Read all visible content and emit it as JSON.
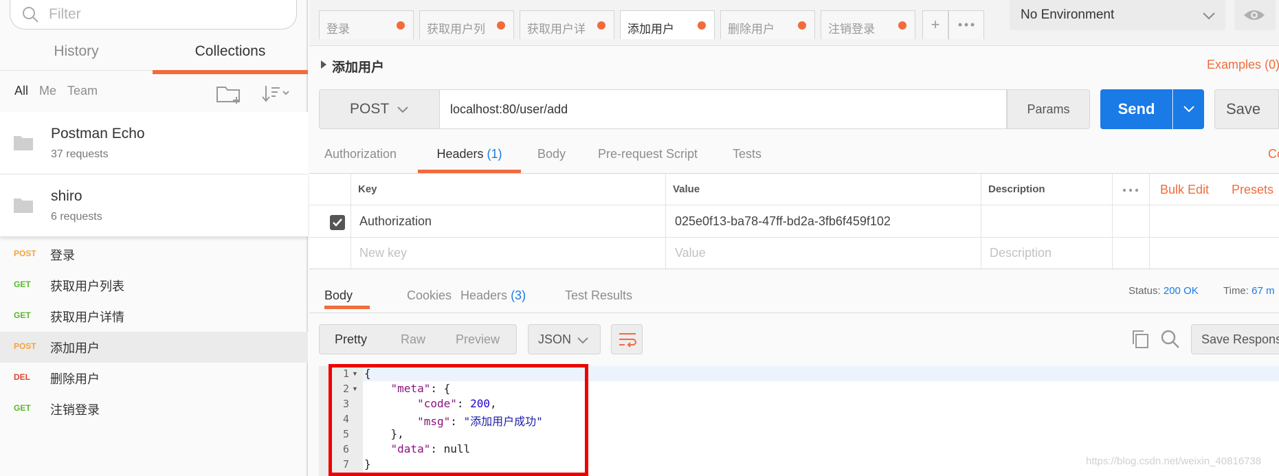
{
  "sidebar": {
    "filter_placeholder": "Filter",
    "tabs": [
      "History",
      "Collections"
    ],
    "owners": [
      "All",
      "Me",
      "Team"
    ],
    "collections": [
      {
        "name": "Postman Echo",
        "count": "37 requests"
      },
      {
        "name": "shiro",
        "count": "6 requests"
      }
    ],
    "requests": [
      {
        "method": "POST",
        "name": "登录"
      },
      {
        "method": "GET",
        "name": "获取用户列表"
      },
      {
        "method": "GET",
        "name": "获取用户详情"
      },
      {
        "method": "POST",
        "name": "添加用户"
      },
      {
        "method": "DEL",
        "name": "删除用户"
      },
      {
        "method": "GET",
        "name": "注销登录"
      }
    ]
  },
  "top_tabs": [
    "登录",
    "获取用户列",
    "获取用户详",
    "添加用户",
    "删除用户",
    "注销登录"
  ],
  "new_tab_label": "+",
  "environment": "No Environment",
  "request": {
    "title": "添加用户",
    "examples": "Examples (0)",
    "method": "POST",
    "url": "localhost:80/user/add",
    "params_label": "Params",
    "send_label": "Send",
    "save_label": "Save"
  },
  "request_tabs": {
    "authorization": "Authorization",
    "headers": "Headers",
    "headers_count": "(1)",
    "body": "Body",
    "prerequest": "Pre-request Script",
    "tests": "Tests",
    "code": "Co"
  },
  "headers_table": {
    "col_key": "Key",
    "col_value": "Value",
    "col_description": "Description",
    "bulk_edit": "Bulk Edit",
    "presets": "Presets",
    "row_key": "Authorization",
    "row_value": "025e0f13-ba78-47ff-bd2a-3fb6f459f102",
    "ph_key": "New key",
    "ph_value": "Value",
    "ph_description": "Description"
  },
  "response": {
    "tabs": {
      "body": "Body",
      "cookies": "Cookies",
      "headers": "Headers",
      "headers_count": "(3)",
      "tests": "Test Results"
    },
    "status_label": "Status:",
    "status_value": "200 OK",
    "time_label": "Time:",
    "time_value": "67 m",
    "view_modes": [
      "Pretty",
      "Raw",
      "Preview"
    ],
    "format": "JSON",
    "save_response": "Save Response"
  },
  "code_lines": [
    "1",
    "2",
    "3",
    "4",
    "5",
    "6",
    "7"
  ],
  "code": {
    "l1": "{",
    "l2_key": "\"meta\"",
    "l2_rest": ": {",
    "l3_key": "\"code\"",
    "l3_sep": ": ",
    "l3_val": "200",
    "l3_end": ",",
    "l4_key": "\"msg\"",
    "l4_sep": ": ",
    "l4_val": "\"添加用户成功\"",
    "l5": "},",
    "l6_key": "\"data\"",
    "l6_rest": ": null",
    "l7": "}"
  },
  "watermark": "https://blog.csdn.net/weixin_40816738",
  "colors": {
    "accent": "#f26b3a",
    "send": "#1a7ae6",
    "post": "#f5a33b",
    "get": "#59b82b",
    "del": "#e0432e",
    "highlight": "#ef0000"
  }
}
